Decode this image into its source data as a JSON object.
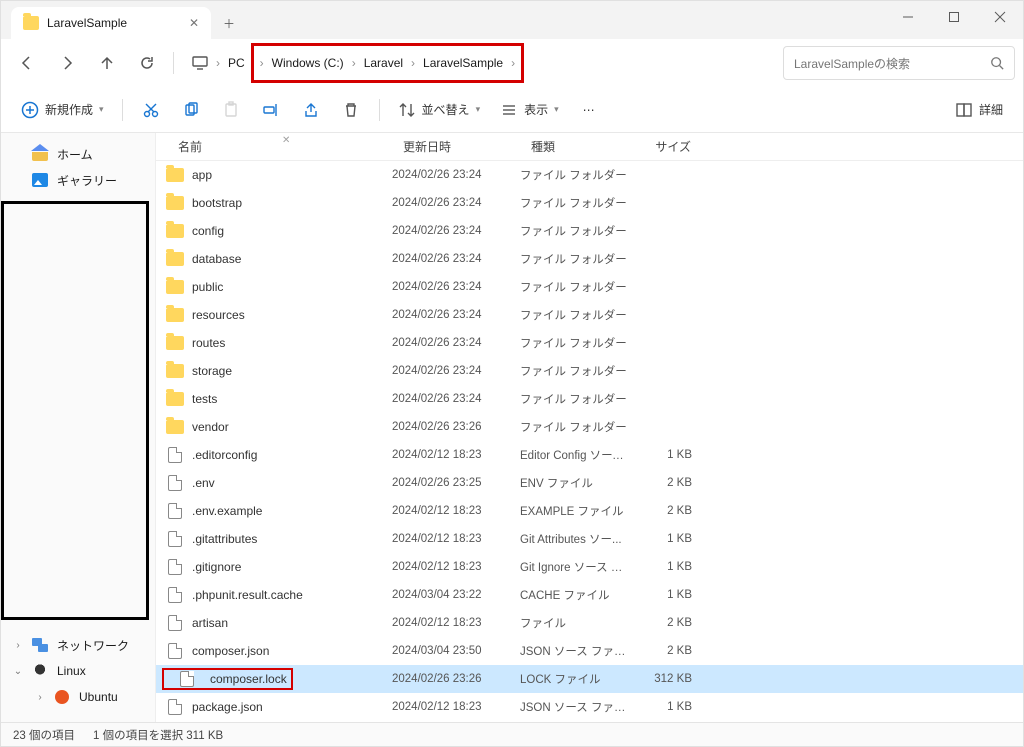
{
  "tab": {
    "title": "LaravelSample"
  },
  "breadcrumb": {
    "pc": "PC",
    "items": [
      "Windows (C:)",
      "Laravel",
      "LaravelSample"
    ]
  },
  "search": {
    "placeholder": "LaravelSampleの検索"
  },
  "toolbar": {
    "new": "新規作成",
    "sort": "並べ替え",
    "view": "表示",
    "details": "詳細"
  },
  "sidebar": {
    "home": "ホーム",
    "gallery": "ギャラリー",
    "network": "ネットワーク",
    "linux": "Linux",
    "ubuntu": "Ubuntu"
  },
  "columns": {
    "name": "名前",
    "date": "更新日時",
    "type": "種類",
    "size": "サイズ"
  },
  "files": [
    {
      "name": "app",
      "date": "2024/02/26 23:24",
      "type": "ファイル フォルダー",
      "size": "",
      "icon": "folder"
    },
    {
      "name": "bootstrap",
      "date": "2024/02/26 23:24",
      "type": "ファイル フォルダー",
      "size": "",
      "icon": "folder"
    },
    {
      "name": "config",
      "date": "2024/02/26 23:24",
      "type": "ファイル フォルダー",
      "size": "",
      "icon": "folder"
    },
    {
      "name": "database",
      "date": "2024/02/26 23:24",
      "type": "ファイル フォルダー",
      "size": "",
      "icon": "folder"
    },
    {
      "name": "public",
      "date": "2024/02/26 23:24",
      "type": "ファイル フォルダー",
      "size": "",
      "icon": "folder"
    },
    {
      "name": "resources",
      "date": "2024/02/26 23:24",
      "type": "ファイル フォルダー",
      "size": "",
      "icon": "folder"
    },
    {
      "name": "routes",
      "date": "2024/02/26 23:24",
      "type": "ファイル フォルダー",
      "size": "",
      "icon": "folder"
    },
    {
      "name": "storage",
      "date": "2024/02/26 23:24",
      "type": "ファイル フォルダー",
      "size": "",
      "icon": "folder"
    },
    {
      "name": "tests",
      "date": "2024/02/26 23:24",
      "type": "ファイル フォルダー",
      "size": "",
      "icon": "folder"
    },
    {
      "name": "vendor",
      "date": "2024/02/26 23:26",
      "type": "ファイル フォルダー",
      "size": "",
      "icon": "folder"
    },
    {
      "name": ".editorconfig",
      "date": "2024/02/12 18:23",
      "type": "Editor Config ソース...",
      "size": "1 KB",
      "icon": "file"
    },
    {
      "name": ".env",
      "date": "2024/02/26 23:25",
      "type": "ENV ファイル",
      "size": "2 KB",
      "icon": "file"
    },
    {
      "name": ".env.example",
      "date": "2024/02/12 18:23",
      "type": "EXAMPLE ファイル",
      "size": "2 KB",
      "icon": "file"
    },
    {
      "name": ".gitattributes",
      "date": "2024/02/12 18:23",
      "type": "Git Attributes ソー...",
      "size": "1 KB",
      "icon": "file"
    },
    {
      "name": ".gitignore",
      "date": "2024/02/12 18:23",
      "type": "Git Ignore ソース フ...",
      "size": "1 KB",
      "icon": "file"
    },
    {
      "name": ".phpunit.result.cache",
      "date": "2024/03/04 23:22",
      "type": "CACHE ファイル",
      "size": "1 KB",
      "icon": "file"
    },
    {
      "name": "artisan",
      "date": "2024/02/12 18:23",
      "type": "ファイル",
      "size": "2 KB",
      "icon": "file"
    },
    {
      "name": "composer.json",
      "date": "2024/03/04 23:50",
      "type": "JSON ソース ファイル",
      "size": "2 KB",
      "icon": "file"
    },
    {
      "name": "composer.lock",
      "date": "2024/02/26 23:26",
      "type": "LOCK ファイル",
      "size": "312 KB",
      "icon": "file",
      "selected": true,
      "redbox": true
    },
    {
      "name": "package.json",
      "date": "2024/02/12 18:23",
      "type": "JSON ソース ファイル",
      "size": "1 KB",
      "icon": "file"
    }
  ],
  "status": {
    "count": "23 個の項目",
    "selection": "1 個の項目を選択 311 KB"
  }
}
